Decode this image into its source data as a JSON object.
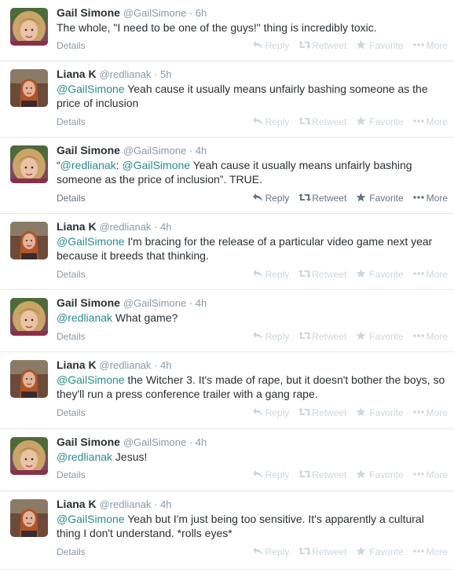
{
  "actions": {
    "reply": "Reply",
    "retweet": "Retweet",
    "favorite": "Favorite",
    "more": "More",
    "details": "Details"
  },
  "tweets": [
    {
      "name": "Gail Simone",
      "handle": "@GailSimone",
      "time": "6h",
      "parts": [
        {
          "t": "The whole, \"I need to be one of the guys!\" thing is incredibly toxic.",
          "m": false
        }
      ],
      "active": false
    },
    {
      "name": "Liana K",
      "handle": "@redlianak",
      "time": "5h",
      "parts": [
        {
          "t": "@GailSimone",
          "m": true
        },
        {
          "t": " Yeah cause it usually means unfairly bashing someone as the price of inclusion",
          "m": false
        }
      ],
      "active": false
    },
    {
      "name": "Gail Simone",
      "handle": "@GailSimone",
      "time": "4h",
      "parts": [
        {
          "t": "“",
          "m": false
        },
        {
          "t": "@redlianak",
          "m": true
        },
        {
          "t": ": ",
          "m": false
        },
        {
          "t": "@GailSimone",
          "m": true
        },
        {
          "t": " Yeah cause it usually means unfairly bashing someone as the price of inclusion”. TRUE.",
          "m": false
        }
      ],
      "active": true
    },
    {
      "name": "Liana K",
      "handle": "@redlianak",
      "time": "4h",
      "parts": [
        {
          "t": "@GailSimone",
          "m": true
        },
        {
          "t": " I'm bracing for the release of a particular video game next year because it breeds that thinking.",
          "m": false
        }
      ],
      "active": false
    },
    {
      "name": "Gail Simone",
      "handle": "@GailSimone",
      "time": "4h",
      "parts": [
        {
          "t": "@redlianak",
          "m": true
        },
        {
          "t": " What game?",
          "m": false
        }
      ],
      "active": false
    },
    {
      "name": "Liana K",
      "handle": "@redlianak",
      "time": "4h",
      "parts": [
        {
          "t": "@GailSimone",
          "m": true
        },
        {
          "t": " the Witcher 3. It's made of rape,  but it doesn't bother the boys, so they'll run a press conference trailer with a gang rape.",
          "m": false
        }
      ],
      "active": false
    },
    {
      "name": "Gail Simone",
      "handle": "@GailSimone",
      "time": "4h",
      "parts": [
        {
          "t": "@redlianak",
          "m": true
        },
        {
          "t": " Jesus!",
          "m": false
        }
      ],
      "active": false
    },
    {
      "name": "Liana K",
      "handle": "@redlianak",
      "time": "4h",
      "parts": [
        {
          "t": "@GailSimone",
          "m": true
        },
        {
          "t": " Yeah but I'm just being too sensitive.  It's apparently a cultural thing I don't understand.   *rolls eyes*",
          "m": false
        }
      ],
      "active": false
    }
  ]
}
